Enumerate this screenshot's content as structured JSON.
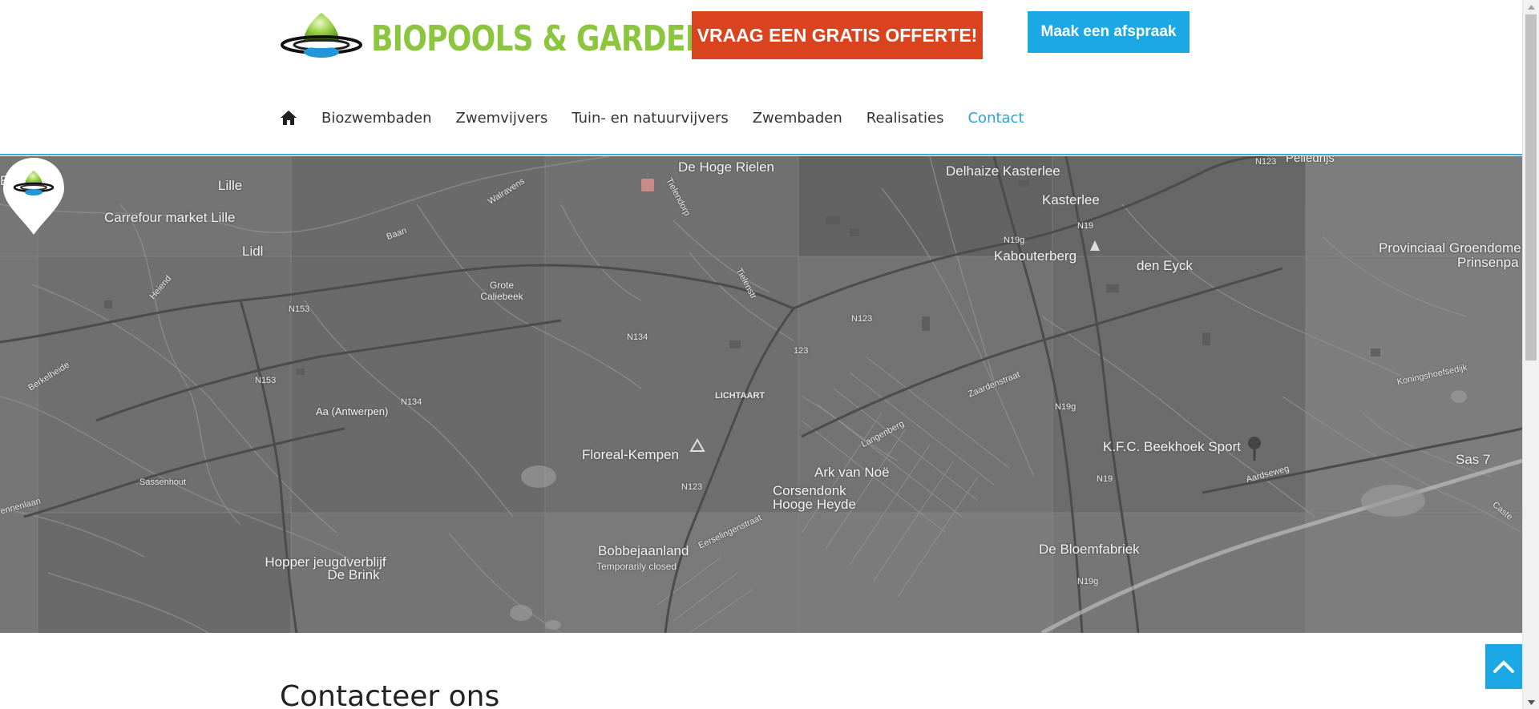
{
  "header": {
    "brand_name": "BIOPOOLS & GARDENS",
    "quote_button": "VRAAG EEN GRATIS OFFERTE!",
    "appointment_button": "Maak een afspraak",
    "colors": {
      "brand_green": "#8cc63f",
      "quote_red": "#d9441f",
      "accent_blue": "#1ba8e5"
    }
  },
  "nav": {
    "home_icon": "home-icon",
    "items": [
      {
        "label": "Biozwembaden",
        "active": false
      },
      {
        "label": "Zwemvijvers",
        "active": false
      },
      {
        "label": "Tuin- en natuurvijvers",
        "active": false
      },
      {
        "label": "Zwembaden",
        "active": false
      },
      {
        "label": "Realisaties",
        "active": false
      },
      {
        "label": "Contact",
        "active": true
      }
    ]
  },
  "map": {
    "labels": {
      "e": "E)",
      "lille": "Lille",
      "carrefour": "Carrefour market Lille",
      "lidl": "Lidl",
      "walravens": "Walravens",
      "baan": "Baan",
      "heiend": "Heiend",
      "grote_caliebeek_1": "Grote",
      "grote_caliebeek_2": "Caliebeek",
      "n153a": "N153",
      "n153b": "N153",
      "berkelheide": "Berkelheide",
      "aa_antwerpen": "Aa (Antwerpen)",
      "n134a": "N134",
      "n134b": "N134",
      "sassenhout": "Sassenhout",
      "ennenlaan": "ennenlaan",
      "hopper_1": "Hopper jeugdverblijf",
      "hopper_2": "De Brink",
      "de_hoge_rielen": "De Hoge Rielen",
      "tielendorp": "Tielendorp",
      "tielenstr": "Tielenstr",
      "n123a": "N123",
      "n123b": "123",
      "lichtaart": "LICHTAART",
      "floreal": "Floreal-Kempen",
      "n123c": "N123",
      "ark_van_noe": "Ark van Noë",
      "corsendonk_1": "Corsendonk",
      "corsendonk_2": "Hooge Heyde",
      "bobbejaanland": "Bobbejaanland",
      "temporarily_closed": "Temporarily closed",
      "eerselingenstraat": "Eerselingenstraat",
      "langenberg": "Langenberg",
      "zaardenstraat": "Zaardenstraat",
      "delhaize": "Delhaize Kasterlee",
      "kasterlee": "Kasterlee",
      "n19a": "N19",
      "n19g_a": "N19g",
      "kabouterberg": "Kabouterberg",
      "den_eyck": "den Eyck",
      "n19g_b": "N19g",
      "kfc": "K.F.C. Beekhoek Sport",
      "n19b": "N19",
      "aardseweg": "Aardseweg",
      "bloemfabriek": "De Bloemfabriek",
      "n19g_c": "N19g",
      "provinciaal_1": "Provinciaal Groendome",
      "provinciaal_2": "Prinsenpa",
      "koningshoefsedijk": "Koningshoefsedijk",
      "sas7": "Sas 7",
      "caste": "Caste",
      "n123_top": "N123",
      "pelledrijs": "Pelledrijs"
    }
  },
  "content": {
    "contact_title": "Contacteer ons"
  }
}
